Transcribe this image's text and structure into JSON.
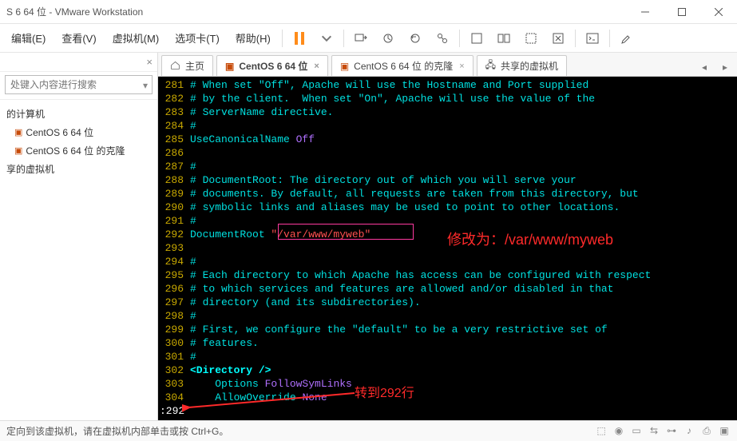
{
  "window": {
    "title": "S 6 64 位 - VMware Workstation"
  },
  "menus": {
    "edit": "编辑(E)",
    "view": "查看(V)",
    "vm": "虚拟机(M)",
    "tabs": "选项卡(T)",
    "help": "帮助(H)"
  },
  "sidebar": {
    "search_placeholder": "处键入内容进行搜索",
    "root": "的计算机",
    "vm1": "CentOS 6 64 位",
    "vm2": "CentOS 6 64 位 的克隆",
    "shared": "享的虚拟机"
  },
  "tabs": {
    "home": "主页",
    "t1": "CentOS 6 64 位",
    "t2": "CentOS 6 64 位 的克隆",
    "t3": "共享的虚拟机"
  },
  "term": {
    "l281": {
      "n": "281",
      "t": "# When set \"Off\", Apache will use the Hostname and Port supplied"
    },
    "l282": {
      "n": "282",
      "t": "# by the client.  When set \"On\", Apache will use the value of the"
    },
    "l283": {
      "n": "283",
      "t": "# ServerName directive."
    },
    "l284": {
      "n": "284",
      "t": "#"
    },
    "l285": {
      "n": "285",
      "a": "UseCanonicalName ",
      "b": "Off"
    },
    "l286": {
      "n": "286",
      "t": ""
    },
    "l287": {
      "n": "287",
      "t": "#"
    },
    "l288": {
      "n": "288",
      "t": "# DocumentRoot: The directory out of which you will serve your"
    },
    "l289": {
      "n": "289",
      "t": "# documents. By default, all requests are taken from this directory, but"
    },
    "l290": {
      "n": "290",
      "t": "# symbolic links and aliases may be used to point to other locations."
    },
    "l291": {
      "n": "291",
      "t": "#"
    },
    "l292": {
      "n": "292",
      "a": "DocumentRoot ",
      "b": "\"/var/www/myweb\""
    },
    "l293": {
      "n": "293",
      "t": ""
    },
    "l294": {
      "n": "294",
      "t": "#"
    },
    "l295": {
      "n": "295",
      "t": "# Each directory to which Apache has access can be configured with respect"
    },
    "l296": {
      "n": "296",
      "t": "# to which services and features are allowed and/or disabled in that"
    },
    "l297": {
      "n": "297",
      "t": "# directory (and its subdirectories)."
    },
    "l298": {
      "n": "298",
      "t": "#"
    },
    "l299": {
      "n": "299",
      "t": "# First, we configure the \"default\" to be a very restrictive set of"
    },
    "l300": {
      "n": "300",
      "t": "# features."
    },
    "l301": {
      "n": "301",
      "t": "#"
    },
    "l302": {
      "n": "302",
      "t": "<Directory />"
    },
    "l303": {
      "n": "303",
      "a": "    Options ",
      "b": "FollowSymLinks"
    },
    "l304": {
      "n": "304",
      "a": "    AllowOverride ",
      "b": "None"
    },
    "cmd": ":292"
  },
  "annot": {
    "modify": "修改为：/var/www/myweb",
    "goto": "转到292行"
  },
  "status": {
    "text": "定向到该虚拟机，请在虚拟机内部单击或按 Ctrl+G。"
  }
}
